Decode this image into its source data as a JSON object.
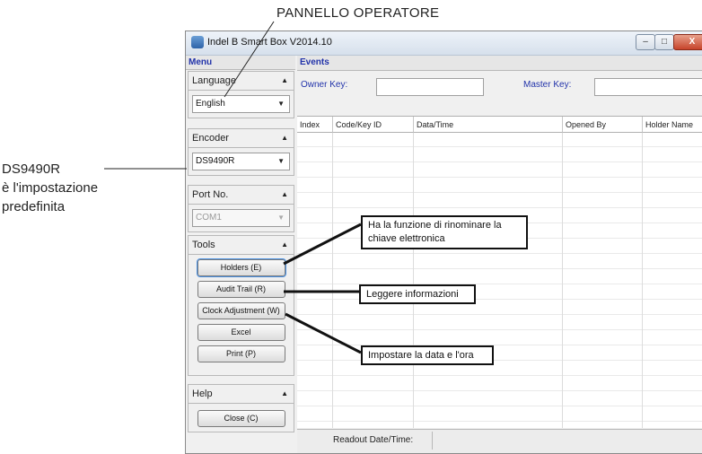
{
  "annotations": {
    "title": "PANNELLO OPERATORE",
    "encoder_line1": "DS9490R",
    "encoder_line2": "è l'impostazione",
    "encoder_line3": "predefinita"
  },
  "window": {
    "title": "Indel B Smart Box V2014.10",
    "min_label": "–",
    "max_label": "□",
    "close_label": "X"
  },
  "menu": {
    "header": "Menu",
    "language": {
      "label": "Language",
      "value": "English"
    },
    "encoder": {
      "label": "Encoder",
      "value": "DS9490R"
    },
    "port": {
      "label": "Port No.",
      "value": "COM1"
    },
    "tools": {
      "label": "Tools",
      "buttons": [
        "Holders (E)",
        "Audit Trail (R)",
        "Clock Adjustment (W)",
        "Excel",
        "Print (P)"
      ]
    },
    "help": {
      "label": "Help",
      "close_button": "Close (C)"
    }
  },
  "events": {
    "header": "Events",
    "owner_key_label": "Owner Key:",
    "master_key_label": "Master Key:",
    "columns": [
      "Index",
      "Code/Key ID",
      "Data/Time",
      "Opened By",
      "Holder Name"
    ],
    "status_label": "Readout Date/Time:"
  },
  "callouts": {
    "holders": "Ha la funzione di rinominare la chiave elettronica",
    "audit": "Leggere informazioni",
    "clock": "Impostare la data e l'ora"
  }
}
